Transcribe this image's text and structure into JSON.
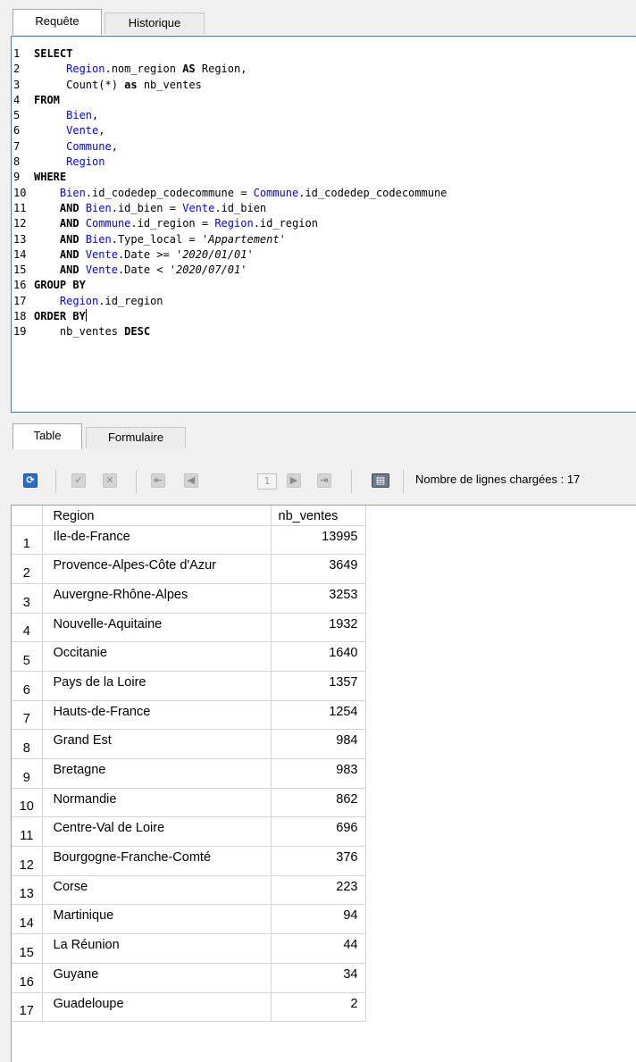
{
  "top_tabs": [
    "Requête",
    "Historique"
  ],
  "sql_lines": [
    [
      {
        "t": "1 "
      },
      {
        "t": "SELECT",
        "c": "kw"
      }
    ],
    [
      {
        "t": "2"
      },
      {
        "t": "     "
      },
      {
        "t": "Region",
        "c": "id"
      },
      {
        "t": ".nom_region "
      },
      {
        "t": "AS",
        "c": "kw"
      },
      {
        "t": " Region,"
      }
    ],
    [
      {
        "t": "3"
      },
      {
        "t": "     Count(*) "
      },
      {
        "t": "as",
        "c": "kw"
      },
      {
        "t": " nb_ventes"
      }
    ],
    [
      {
        "t": "4 "
      },
      {
        "t": "FROM",
        "c": "kw"
      }
    ],
    [
      {
        "t": "5"
      },
      {
        "t": "     "
      },
      {
        "t": "Bien",
        "c": "id"
      },
      {
        "t": ","
      }
    ],
    [
      {
        "t": "6"
      },
      {
        "t": "     "
      },
      {
        "t": "Vente",
        "c": "id"
      },
      {
        "t": ","
      }
    ],
    [
      {
        "t": "7"
      },
      {
        "t": "     "
      },
      {
        "t": "Commune",
        "c": "id"
      },
      {
        "t": ","
      }
    ],
    [
      {
        "t": "8"
      },
      {
        "t": "     "
      },
      {
        "t": "Region",
        "c": "id"
      }
    ],
    [
      {
        "t": "9 "
      },
      {
        "t": "WHERE",
        "c": "kw"
      }
    ],
    [
      {
        "t": "10"
      },
      {
        "t": "    "
      },
      {
        "t": "Bien",
        "c": "id"
      },
      {
        "t": ".id_codedep_codecommune = "
      },
      {
        "t": "Commune",
        "c": "id"
      },
      {
        "t": ".id_codedep_codecommune"
      }
    ],
    [
      {
        "t": "11"
      },
      {
        "t": "    "
      },
      {
        "t": "AND",
        "c": "kw"
      },
      {
        "t": " "
      },
      {
        "t": "Bien",
        "c": "id"
      },
      {
        "t": ".id_bien = "
      },
      {
        "t": "Vente",
        "c": "id"
      },
      {
        "t": ".id_bien"
      }
    ],
    [
      {
        "t": "12"
      },
      {
        "t": "    "
      },
      {
        "t": "AND",
        "c": "kw"
      },
      {
        "t": " "
      },
      {
        "t": "Commune",
        "c": "id"
      },
      {
        "t": ".id_region = "
      },
      {
        "t": "Region",
        "c": "id"
      },
      {
        "t": ".id_region"
      }
    ],
    [
      {
        "t": "13"
      },
      {
        "t": "    "
      },
      {
        "t": "AND",
        "c": "kw"
      },
      {
        "t": " "
      },
      {
        "t": "Bien",
        "c": "id"
      },
      {
        "t": ".Type_local = "
      },
      {
        "t": "'Appartement'",
        "c": "str"
      }
    ],
    [
      {
        "t": "14"
      },
      {
        "t": "    "
      },
      {
        "t": "AND",
        "c": "kw"
      },
      {
        "t": " "
      },
      {
        "t": "Vente",
        "c": "id"
      },
      {
        "t": ".Date >= "
      },
      {
        "t": "'2020/01/01'",
        "c": "str"
      }
    ],
    [
      {
        "t": "15"
      },
      {
        "t": "    "
      },
      {
        "t": "AND",
        "c": "kw"
      },
      {
        "t": " "
      },
      {
        "t": "Vente",
        "c": "id"
      },
      {
        "t": ".Date < "
      },
      {
        "t": "'2020/07/01'",
        "c": "str"
      }
    ],
    [
      {
        "t": "16 "
      },
      {
        "t": "GROUP BY",
        "c": "kw"
      }
    ],
    [
      {
        "t": "17"
      },
      {
        "t": "    "
      },
      {
        "t": "Region",
        "c": "id"
      },
      {
        "t": ".id_region"
      }
    ],
    [
      {
        "t": "18 "
      },
      {
        "t": "ORDER BY",
        "c": "kw"
      },
      {
        "t": "",
        "c": "caret"
      }
    ],
    [
      {
        "t": "19"
      },
      {
        "t": "    nb_ventes "
      },
      {
        "t": "DESC",
        "c": "kw"
      }
    ]
  ],
  "result_tabs": [
    "Table",
    "Formulaire"
  ],
  "toolbar": {
    "page_number": "1",
    "rows_loaded": "Nombre de lignes chargées : 17",
    "colors": {
      "refresh": "#2b6cc4",
      "disabled": "#d4d4d4"
    }
  },
  "grid": {
    "columns": [
      "Region",
      "nb_ventes"
    ],
    "rows": [
      [
        "1",
        "Ile-de-France",
        "13995"
      ],
      [
        "2",
        "Provence-Alpes-Côte d'Azur",
        "3649"
      ],
      [
        "3",
        "Auvergne-Rhône-Alpes",
        "3253"
      ],
      [
        "4",
        "Nouvelle-Aquitaine",
        "1932"
      ],
      [
        "5",
        "Occitanie",
        "1640"
      ],
      [
        "6",
        "Pays de la Loire",
        "1357"
      ],
      [
        "7",
        "Hauts-de-France",
        "1254"
      ],
      [
        "8",
        "Grand Est",
        "984"
      ],
      [
        "9",
        "Bretagne",
        "983"
      ],
      [
        "10",
        "Normandie",
        "862"
      ],
      [
        "11",
        "Centre-Val de Loire",
        "696"
      ],
      [
        "12",
        "Bourgogne-Franche-Comté",
        "376"
      ],
      [
        "13",
        "Corse",
        "223"
      ],
      [
        "14",
        "Martinique",
        "94"
      ],
      [
        "15",
        "La Réunion",
        "44"
      ],
      [
        "16",
        "Guyane",
        "34"
      ],
      [
        "17",
        "Guadeloupe",
        "2"
      ]
    ]
  }
}
